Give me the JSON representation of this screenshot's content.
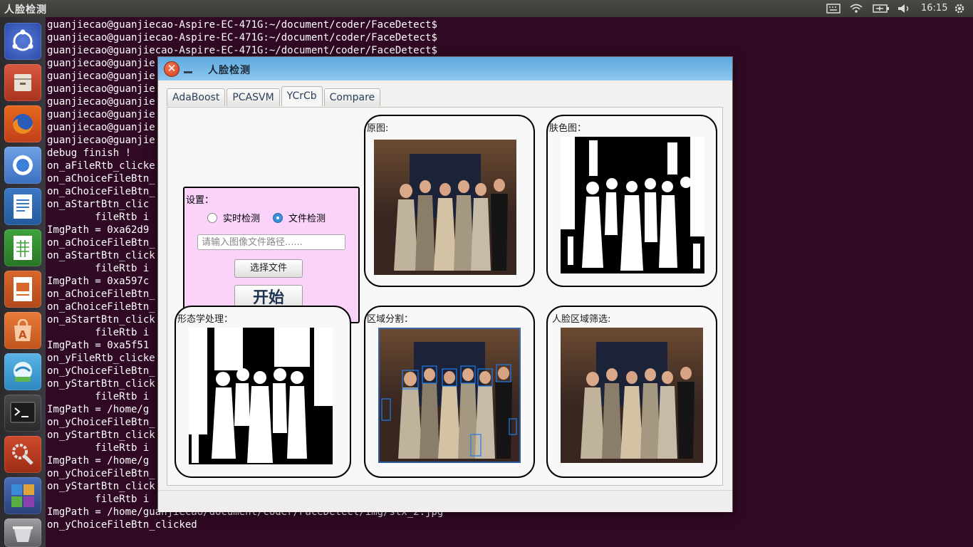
{
  "top_panel": {
    "app_title": "人脸检测",
    "clock": "16:15"
  },
  "terminal": {
    "lines": [
      "guanjiecao@guanjiecao-Aspire-EC-471G:~/document/coder/FaceDetect$",
      "guanjiecao@guanjiecao-Aspire-EC-471G:~/document/coder/FaceDetect$",
      "guanjiecao@guanjiecao-Aspire-EC-471G:~/document/coder/FaceDetect$",
      "guanjiecao@guanjie",
      "guanjiecao@guanjie",
      "guanjiecao@guanjie",
      "guanjiecao@guanjie",
      "guanjiecao@guanjie",
      "guanjiecao@guanjie",
      "guanjiecao@guanjie",
      "debug finish !",
      "on_aFileRtb_clicke",
      "on_aChoiceFileBtn_",
      "on_aChoiceFileBtn_",
      "on_aStartBtn_clic",
      "        fileRtb i",
      "ImgPath = 0xa62d9",
      "on_aChoiceFileBtn_",
      "on_aStartBtn_click",
      "        fileRtb i",
      "ImgPath = 0xa597c",
      "on_aChoiceFileBtn_",
      "on_aChoiceFileBtn_",
      "on_aStartBtn_click",
      "        fileRtb i",
      "ImgPath = 0xa5f51",
      "on_yFileRtb_clicke",
      "on_yChoiceFileBtn_",
      "on_yStartBtn_click",
      "        fileRtb i",
      "ImgPath = /home/g",
      "on_yChoiceFileBtn_",
      "on_yStartBtn_click",
      "        fileRtb i",
      "ImgPath = /home/g",
      "on_yChoiceFileBtn_",
      "on_yStartBtn_click",
      "        fileRtb i",
      "ImgPath = /home/guanjiecao/document/coder/FaceDetect/img/stx_2.jpg",
      "on_yChoiceFileBtn_clicked"
    ]
  },
  "window": {
    "title": "人脸检测",
    "close_glyph": "✕",
    "tabs": [
      "AdaBoost",
      "PCASVM",
      "YCrCb",
      "Compare"
    ],
    "active_tab": "YCrCb",
    "settings": {
      "label": "设置：",
      "radio_realtime": "实时检测",
      "radio_file": "文件检测",
      "selected": "文件检测",
      "path_placeholder": "请输入图像文件路径......",
      "choose_file_button": "选择文件",
      "start_button": "开始"
    },
    "panels": {
      "original": "原图:",
      "skin": "肤色图：",
      "morph": "形态学处理：",
      "region": "区域分割：",
      "face": "人脸区域筛选:"
    }
  },
  "launcher": {
    "icons": [
      "ubuntu-dash-icon",
      "files-icon",
      "firefox-icon",
      "chromium-icon",
      "writer-icon",
      "calc-icon",
      "impress-icon",
      "software-center-icon",
      "app-icon",
      "terminal-icon",
      "settings-icon",
      "workspace-switcher-icon",
      "trash-icon"
    ]
  }
}
